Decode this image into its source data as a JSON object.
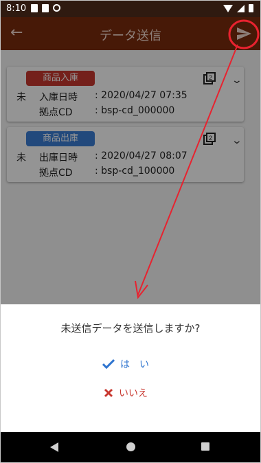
{
  "status_bar": {
    "time": "8:10"
  },
  "app_bar": {
    "back_icon": "arrow-left-icon",
    "title": "データ送信",
    "send_icon": "send-icon"
  },
  "cards": [
    {
      "badge": "商品入庫",
      "badge_color": "#c8372f",
      "status": "未",
      "date_label": "入庫日時",
      "date_value": ": 2020/04/27 07:35",
      "location_label": "拠点CD",
      "location_value": ": bsp-cd_000000"
    },
    {
      "badge": "商品出庫",
      "badge_color": "#3b7ed6",
      "status": "未",
      "date_label": "出庫日時",
      "date_value": ": 2020/04/27 08:07",
      "location_label": "拠点CD",
      "location_value": ": bsp-cd_100000"
    }
  ],
  "dialog": {
    "question": "未送信データを送信しますか?",
    "yes_label": "は　い",
    "no_label": "いいえ"
  },
  "colors": {
    "appbar": "#7b2b0d",
    "accent_blue": "#2e74cf",
    "accent_red": "#c8372f",
    "annotation": "#e8222f"
  }
}
